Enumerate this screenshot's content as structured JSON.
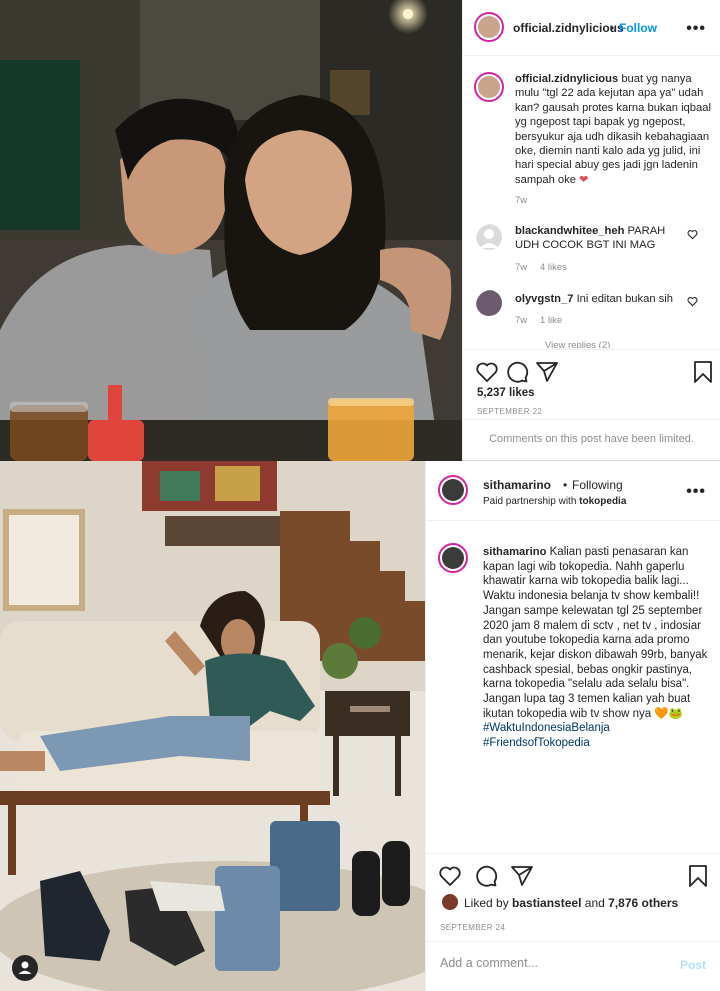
{
  "post1": {
    "username": "official.zidnylicious",
    "follow_label": "Follow",
    "dot": "•",
    "more": "•••",
    "caption": "buat yg nanya mulu \"tgl 22 ada kejutan apa ya\" udah kan? gausah protes karna bukan iqbaal yg ngepost tapi bapak yg ngepost, bersyukur aja udh dikasih kebahagiaan oke, diemin nanti kalo ada yg julid, ini hari special abuy ges jadi jgn ladenin sampah oke",
    "caption_emoji": "❤",
    "caption_time": "7w",
    "comments": [
      {
        "username": "blackandwhitee_heh",
        "text": "PARAH UDH COCOK BGT INI MAG",
        "time": "7w",
        "likes": "4 likes"
      },
      {
        "username": "olyvgstn_7",
        "text": "Ini editan bukan sih",
        "time": "7w",
        "likes": "1 like"
      }
    ],
    "view_replies": "View replies (2)",
    "likes": "5,237 likes",
    "date": "SEPTEMBER 22",
    "limited_text": "Comments on this post have been limited."
  },
  "post2": {
    "username": "sithamarino",
    "following_label": "Following",
    "dot": "•",
    "partnership": "Paid partnership with",
    "partner": "tokopedia",
    "more": "•••",
    "caption_lines": [
      "Kalian pasti penasaran kan kapan lagi wib tokopedia. Nahh gaperlu khawatir karna wib tokopedia balik lagi...",
      "Waktu indonesia belanja tv show kembali!!",
      "Jangan sampe kelewatan tgl 25 september 2020 jam 8 malem di sctv , net tv , indosiar dan youtube tokopedia karna ada promo menarik, kejar diskon dibawah 99rb, banyak cashback spesial, bebas ongkir pastinya, karna tokopedia \"selalu ada selalu bisa\".",
      "Jangan lupa tag 3 temen kalian yah buat ikutan tokopedia wib tv show nya"
    ],
    "caption_emoji": "🧡🐸",
    "hashtags": [
      "#WaktuIndonesiaBelanja",
      "#FriendsofTokopedia"
    ],
    "liked_by_prefix": "Liked by",
    "liked_by_user": "bastiansteel",
    "liked_by_suffix": "and",
    "liked_by_count": "7,876 others",
    "date": "SEPTEMBER 24",
    "comment_placeholder": "Add a comment...",
    "post_label": "Post"
  },
  "icons": {
    "heart": "heart-icon",
    "comment": "comment-icon",
    "share": "paper-plane-icon",
    "save": "bookmark-icon",
    "user": "user-tag-icon"
  },
  "colors": {
    "link_blue": "#0095f6",
    "heart_red": "#ed4956",
    "muted": "#8e8e8e",
    "story_ring": "#d6249f"
  }
}
